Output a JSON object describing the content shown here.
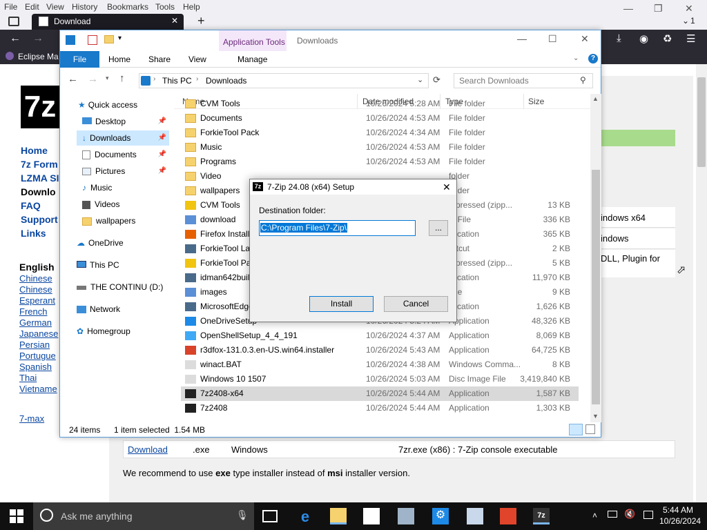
{
  "browser": {
    "menu": [
      "File",
      "Edit",
      "View",
      "History",
      "Bookmarks",
      "Tools",
      "Help"
    ],
    "tab_title": "Download",
    "tab_count_label": "1",
    "bookmark_label": "Eclipse Ma"
  },
  "site": {
    "logo_text": "7z",
    "nav_links": [
      "Home",
      "7z Form",
      "LZMA SI",
      "Downlo",
      "FAQ",
      "Support",
      "Links"
    ],
    "lang_heading": "English",
    "languages": [
      "Chinese",
      "Chinese",
      "Esperant",
      "French",
      "German",
      "Japanese",
      "Persian",
      "Portugue",
      "Spanish",
      "Thai",
      "Vietname"
    ],
    "footer_link": "7-max",
    "right_snippets": [
      "indows x64",
      "indows",
      "DLL, Plugin for"
    ],
    "download_row": {
      "link": "Download",
      "ext": ".exe",
      "os": "Windows",
      "desc": "7zr.exe (x86) : 7-Zip console executable"
    },
    "recommend_pre": "We recommend to use ",
    "recommend_exe": "exe",
    "recommend_mid": " type installer instead of ",
    "recommend_msi": "msi",
    "recommend_post": " installer version."
  },
  "explorer": {
    "title": "Downloads",
    "contextual_tab": "Application Tools",
    "ribbon_tabs": [
      "File",
      "Home",
      "Share",
      "View",
      "Manage"
    ],
    "breadcrumb": [
      "This PC",
      "Downloads"
    ],
    "search_placeholder": "Search Downloads",
    "columns": {
      "name": "Name",
      "date": "Date modified",
      "type": "Type",
      "size": "Size"
    },
    "nav": {
      "quick_access": "Quick access",
      "desktop": "Desktop",
      "downloads": "Downloads",
      "documents": "Documents",
      "pictures": "Pictures",
      "music": "Music",
      "videos": "Videos",
      "wallpapers": "wallpapers",
      "onedrive": "OneDrive",
      "this_pc": "This PC",
      "drive": "THE CONTINU (D:)",
      "network": "Network",
      "homegroup": "Homegroup"
    },
    "files": [
      {
        "name": "CVM Tools",
        "date": "10/26/2024 5:28 AM",
        "type": "File folder",
        "size": "",
        "kind": "folder"
      },
      {
        "name": "Documents",
        "date": "10/26/2024 4:53 AM",
        "type": "File folder",
        "size": "",
        "kind": "folder"
      },
      {
        "name": "ForkieTool Pack",
        "date": "10/26/2024 4:34 AM",
        "type": "File folder",
        "size": "",
        "kind": "folder"
      },
      {
        "name": "Music",
        "date": "10/26/2024 4:53 AM",
        "type": "File folder",
        "size": "",
        "kind": "folder"
      },
      {
        "name": "Programs",
        "date": "10/26/2024 4:53 AM",
        "type": "File folder",
        "size": "",
        "kind": "folder"
      },
      {
        "name": "Video",
        "date": "",
        "type": "folder",
        "size": "",
        "kind": "folder"
      },
      {
        "name": "wallpapers",
        "date": "",
        "type": "folder",
        "size": "",
        "kind": "folder"
      },
      {
        "name": "CVM Tools",
        "date": "",
        "type": "mpressed (zipp...",
        "size": "13 KB",
        "kind": "zip"
      },
      {
        "name": "download",
        "date": "",
        "type": "G File",
        "size": "336 KB",
        "kind": "img"
      },
      {
        "name": "Firefox Installer",
        "date": "",
        "type": "plication",
        "size": "365 KB",
        "kind": "ff"
      },
      {
        "name": "ForkieTool Lau",
        "date": "",
        "type": "ortcut",
        "size": "2 KB",
        "kind": "app"
      },
      {
        "name": "ForkieTool Pac",
        "date": "",
        "type": "mpressed (zipp...",
        "size": "5 KB",
        "kind": "zip"
      },
      {
        "name": "idman642build",
        "date": "",
        "type": "plication",
        "size": "11,970 KB",
        "kind": "app"
      },
      {
        "name": "images",
        "date": "",
        "type": "File",
        "size": "9 KB",
        "kind": "img"
      },
      {
        "name": "MicrosoftEdge",
        "date": "",
        "type": "plication",
        "size": "1,626 KB",
        "kind": "app"
      },
      {
        "name": "OneDriveSetup",
        "date": "10/26/2024 5:24 AM",
        "type": "Application",
        "size": "48,326 KB",
        "kind": "cloud"
      },
      {
        "name": "OpenShellSetup_4_4_191",
        "date": "10/26/2024 4:37 AM",
        "type": "Application",
        "size": "8,069 KB",
        "kind": "shell"
      },
      {
        "name": "r3dfox-131.0.3.en-US.win64.installer",
        "date": "10/26/2024 5:43 AM",
        "type": "Application",
        "size": "64,725 KB",
        "kind": "fox"
      },
      {
        "name": "winact.BAT",
        "date": "10/26/2024 4:38 AM",
        "type": "Windows Comma...",
        "size": "8 KB",
        "kind": "doc"
      },
      {
        "name": "Windows 10 1507",
        "date": "10/26/2024 5:03 AM",
        "type": "Disc Image File",
        "size": "3,419,840 KB",
        "kind": "doc"
      },
      {
        "name": "7z2408-x64",
        "date": "10/26/2024 5:44 AM",
        "type": "Application",
        "size": "1,587 KB",
        "kind": "7z",
        "selected": true
      },
      {
        "name": "7z2408",
        "date": "10/26/2024 5:44 AM",
        "type": "Application",
        "size": "1,303 KB",
        "kind": "7z"
      }
    ],
    "status": {
      "items": "24 items",
      "selected": "1 item selected  1.54 MB"
    }
  },
  "dialog": {
    "title": "7-Zip 24.08 (x64) Setup",
    "dest_label": "Destination folder:",
    "dest_value": "C:\\Program Files\\7-Zip\\",
    "browse_label": "...",
    "install_label": "Install",
    "cancel_label": "Cancel"
  },
  "taskbar": {
    "search_placeholder": "Ask me anything",
    "time": "5:44 AM",
    "date": "10/26/2024"
  }
}
